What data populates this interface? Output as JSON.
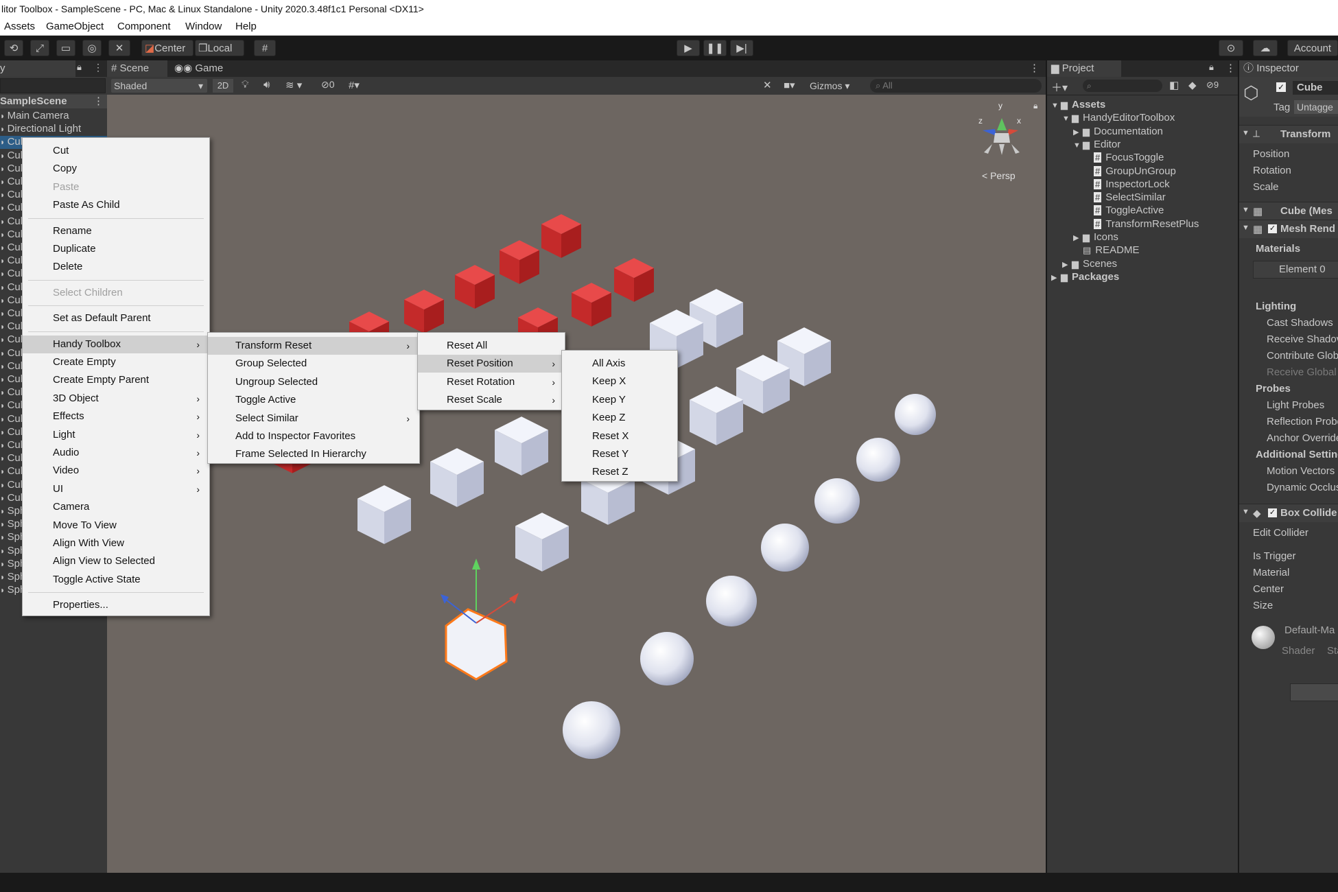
{
  "window": {
    "title": "litor Toolbox - SampleScene - PC, Mac & Linux Standalone - Unity 2020.3.48f1c1 Personal <DX11>"
  },
  "menubar": [
    "Assets",
    "GameObject",
    "Component",
    "Window",
    "Help"
  ],
  "toolbar": {
    "center_label": "Center",
    "local_label": "Local",
    "account_label": "Account"
  },
  "hierarchy": {
    "tab_label": "y",
    "scene_name": "SampleScene",
    "items": [
      "Main Camera",
      "Directional Light",
      "Cub",
      "Cub",
      "Cub",
      "Cub",
      "Cub",
      "Cub",
      "Cub",
      "Cub",
      "Cub",
      "Cub",
      "Cub",
      "Cub",
      "Cub",
      "Cub",
      "Cub",
      "Cub",
      "Cub",
      "Cub",
      "Cub",
      "Cub",
      "Cub",
      "Cub",
      "Cub",
      "Cub",
      "Cub",
      "Cub",
      "Cub",
      "Cub",
      "Sph",
      "Sph",
      "Sph",
      "Sph",
      "Sph",
      "Sph",
      "Sph"
    ]
  },
  "scene": {
    "tabs": [
      "Scene",
      "Game"
    ],
    "shading": "Shaded",
    "mode_2d": "2D",
    "hidden_count": "0",
    "gizmos_label": "Gizmos",
    "search_placeholder": "All",
    "persp_label": "Persp",
    "axis_y": "y",
    "axis_z": "z",
    "axis_x": "x"
  },
  "context_menu": {
    "items": [
      {
        "label": "Cut"
      },
      {
        "label": "Copy"
      },
      {
        "label": "Paste",
        "disabled": true
      },
      {
        "label": "Paste As Child"
      },
      {
        "label": "Rename"
      },
      {
        "label": "Duplicate"
      },
      {
        "label": "Delete"
      },
      {
        "label": "Select Children",
        "disabled": true
      },
      {
        "label": "Set as Default Parent"
      },
      {
        "label": "Handy Toolbox",
        "submenu": true
      },
      {
        "label": "Create Empty"
      },
      {
        "label": "Create Empty Parent"
      },
      {
        "label": "3D Object",
        "submenu": true
      },
      {
        "label": "Effects",
        "submenu": true
      },
      {
        "label": "Light",
        "submenu": true
      },
      {
        "label": "Audio",
        "submenu": true
      },
      {
        "label": "Video",
        "submenu": true
      },
      {
        "label": "UI",
        "submenu": true
      },
      {
        "label": "Camera"
      },
      {
        "label": "Move To View"
      },
      {
        "label": "Align With View"
      },
      {
        "label": "Align View to Selected"
      },
      {
        "label": "Toggle Active State"
      },
      {
        "label": "Properties..."
      }
    ]
  },
  "submenu_handy": [
    "Transform Reset",
    "Group Selected",
    "Ungroup Selected",
    "Toggle Active",
    "Select Similar",
    "Add to Inspector Favorites",
    "Frame Selected In Hierarchy"
  ],
  "submenu_transform_reset": [
    "Reset All",
    "Reset Position",
    "Reset Rotation",
    "Reset Scale"
  ],
  "submenu_reset_position": [
    "All Axis",
    "Keep X",
    "Keep Y",
    "Keep Z",
    "Reset X",
    "Reset Y",
    "Reset Z"
  ],
  "project": {
    "tab_label": "Project",
    "hidden_count": "9",
    "tree": [
      {
        "label": "Assets",
        "type": "folder-open",
        "depth": 0
      },
      {
        "label": "HandyEditorToolbox",
        "type": "folder-open",
        "depth": 1
      },
      {
        "label": "Documentation",
        "type": "folder",
        "depth": 2
      },
      {
        "label": "Editor",
        "type": "folder-open",
        "depth": 2
      },
      {
        "label": "FocusToggle",
        "type": "script",
        "depth": 3
      },
      {
        "label": "GroupUnGroup",
        "type": "script",
        "depth": 3
      },
      {
        "label": "InspectorLock",
        "type": "script",
        "depth": 3
      },
      {
        "label": "SelectSimilar",
        "type": "script",
        "depth": 3
      },
      {
        "label": "ToggleActive",
        "type": "script",
        "depth": 3
      },
      {
        "label": "TransformResetPlus",
        "type": "script",
        "depth": 3
      },
      {
        "label": "Icons",
        "type": "folder",
        "depth": 2
      },
      {
        "label": "README",
        "type": "doc",
        "depth": 2
      },
      {
        "label": "Scenes",
        "type": "folder",
        "depth": 1
      },
      {
        "label": "Packages",
        "type": "folder",
        "depth": 0
      }
    ]
  },
  "inspector": {
    "tab_label": "Inspector",
    "object_name": "Cube",
    "tag_label": "Tag",
    "tag_value": "Untagge",
    "transform_header": "Transform",
    "transform_fields": [
      "Position",
      "Rotation",
      "Scale"
    ],
    "mesh_filter_header": "Cube (Mes",
    "mesh_renderer_header": "Mesh Rend",
    "materials_label": "Materials",
    "element0_label": "Element 0",
    "lighting_label": "Lighting",
    "lighting_fields": [
      "Cast Shadows",
      "Receive Shadov",
      "Contribute Glob"
    ],
    "receive_global": "Receive Global",
    "probes_label": "Probes",
    "probes_fields": [
      "Light Probes",
      "Reflection Probe",
      "Anchor Override"
    ],
    "additional_label": "Additional Setting",
    "additional_fields": [
      "Motion Vectors",
      "Dynamic Occlus"
    ],
    "box_collider_header": "Box Collide",
    "edit_collider": "Edit Collider",
    "collider_fields": [
      "Is Trigger",
      "Material",
      "Center",
      "Size"
    ],
    "material_name": "Default-Ma",
    "shader_label": "Shader",
    "shader_value": "Sta"
  }
}
